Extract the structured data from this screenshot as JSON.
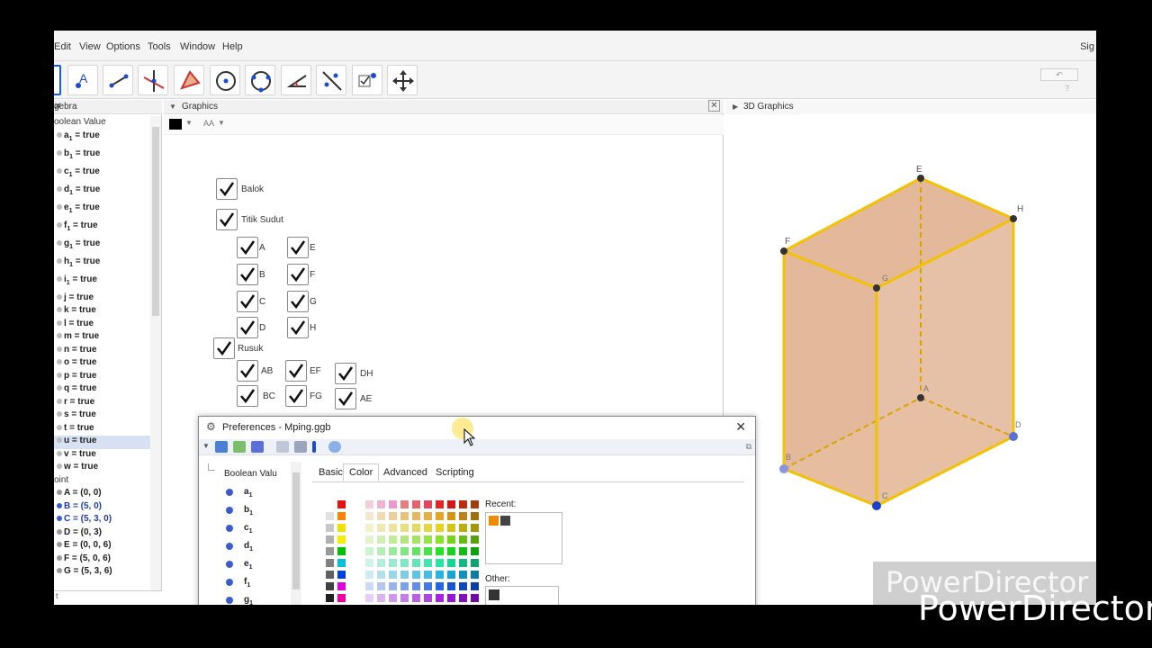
{
  "menubar": {
    "items": [
      "Edit",
      "View",
      "Options",
      "Tools",
      "Window",
      "Help"
    ],
    "signin": "Sig"
  },
  "toolbar": {
    "tools": [
      "move-icon",
      "point-icon",
      "line-icon",
      "perpendicular-icon",
      "polygon-icon",
      "circle-icon",
      "circle-three-points-icon",
      "angle-icon",
      "reflect-icon",
      "checkbox-tool-icon",
      "move-graphics-icon"
    ]
  },
  "algebra": {
    "title": "gebra",
    "group_boolean": "oolean Value",
    "group_point": "oint",
    "rows": [
      {
        "label": "a",
        "sub": "1",
        "value": " = true"
      },
      {
        "label": "b",
        "sub": "1",
        "value": " = true"
      },
      {
        "label": "c",
        "sub": "1",
        "value": " = true"
      },
      {
        "label": "d",
        "sub": "1",
        "value": " = true"
      },
      {
        "label": "e",
        "sub": "1",
        "value": " = true"
      },
      {
        "label": "f",
        "sub": "1",
        "value": " = true"
      },
      {
        "label": "g",
        "sub": "1",
        "value": " = true"
      },
      {
        "label": "h",
        "sub": "1",
        "value": " = true"
      },
      {
        "label": "i",
        "sub": "1",
        "value": " = true"
      },
      {
        "label": "j = true"
      },
      {
        "label": "k = true"
      },
      {
        "label": "l = true"
      },
      {
        "label": "m = true"
      },
      {
        "label": "n = true"
      },
      {
        "label": "o = true"
      },
      {
        "label": "p = true"
      },
      {
        "label": "q = true"
      },
      {
        "label": "r = true"
      },
      {
        "label": "s = true"
      },
      {
        "label": "t = true"
      },
      {
        "label": "u = true"
      },
      {
        "label": "v = true"
      },
      {
        "label": "w = true"
      }
    ],
    "points": [
      "A = (0, 0)",
      "B = (5, 0)",
      "C = (5, 3, 0)",
      "D = (0, 3)",
      "E = (0, 0, 6)",
      "F = (5, 0, 6)",
      "G = (5, 3, 6)"
    ],
    "input_placeholder": "t"
  },
  "graphics": {
    "title": "Graphics",
    "color": "#000000",
    "checkboxes": {
      "balok": "Balok",
      "titik_sudut": "Titik Sudut",
      "A": "A",
      "B": "B",
      "C": "C",
      "D": "D",
      "E": "E",
      "F": "F",
      "G": "G",
      "H": "H",
      "rusuk": "Rusuk",
      "AB": "AB",
      "BC": "BC",
      "EF": "EF",
      "FG": "FG",
      "DH": "DH",
      "AE": "AE"
    }
  },
  "view3d": {
    "title": "3D Graphics",
    "vertex_labels": {
      "E": "E",
      "H": "H",
      "F": "F",
      "G": "G",
      "A": "A",
      "D": "D",
      "C": "C",
      "B": "B"
    },
    "face_color": "#d9a07a",
    "edge_color": "#f2c200"
  },
  "preferences": {
    "title": "Preferences - Mping.ggb",
    "tree_head": "Boolean Valu",
    "tree_items": [
      {
        "label": "a",
        "sub": "1"
      },
      {
        "label": "b",
        "sub": "1"
      },
      {
        "label": "c",
        "sub": "1"
      },
      {
        "label": "d",
        "sub": "1"
      },
      {
        "label": "e",
        "sub": "1"
      },
      {
        "label": "f",
        "sub": "1"
      },
      {
        "label": "g",
        "sub": "1"
      },
      {
        "label": "h",
        "sub": "1"
      }
    ],
    "tabs": [
      "Basic",
      "Color",
      "Advanced",
      "Scripting"
    ],
    "active_tab": "Color",
    "recent_label": "Recent:",
    "other_label": "Other:"
  },
  "watermark": "PowerDirector"
}
